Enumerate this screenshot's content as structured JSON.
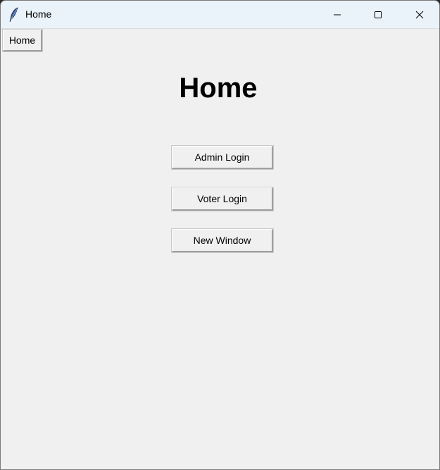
{
  "window": {
    "title": "Home",
    "app_icon": "feather-icon",
    "controls": [
      "minimize-icon",
      "maximize-icon",
      "close-icon"
    ]
  },
  "nav": {
    "home_label": "Home"
  },
  "main": {
    "heading": "Home",
    "buttons": [
      {
        "label": "Admin Login"
      },
      {
        "label": "Voter Login"
      },
      {
        "label": "New Window"
      }
    ]
  },
  "colors": {
    "background": "#f0f0f0",
    "titlebar": "#eaf3f9"
  }
}
